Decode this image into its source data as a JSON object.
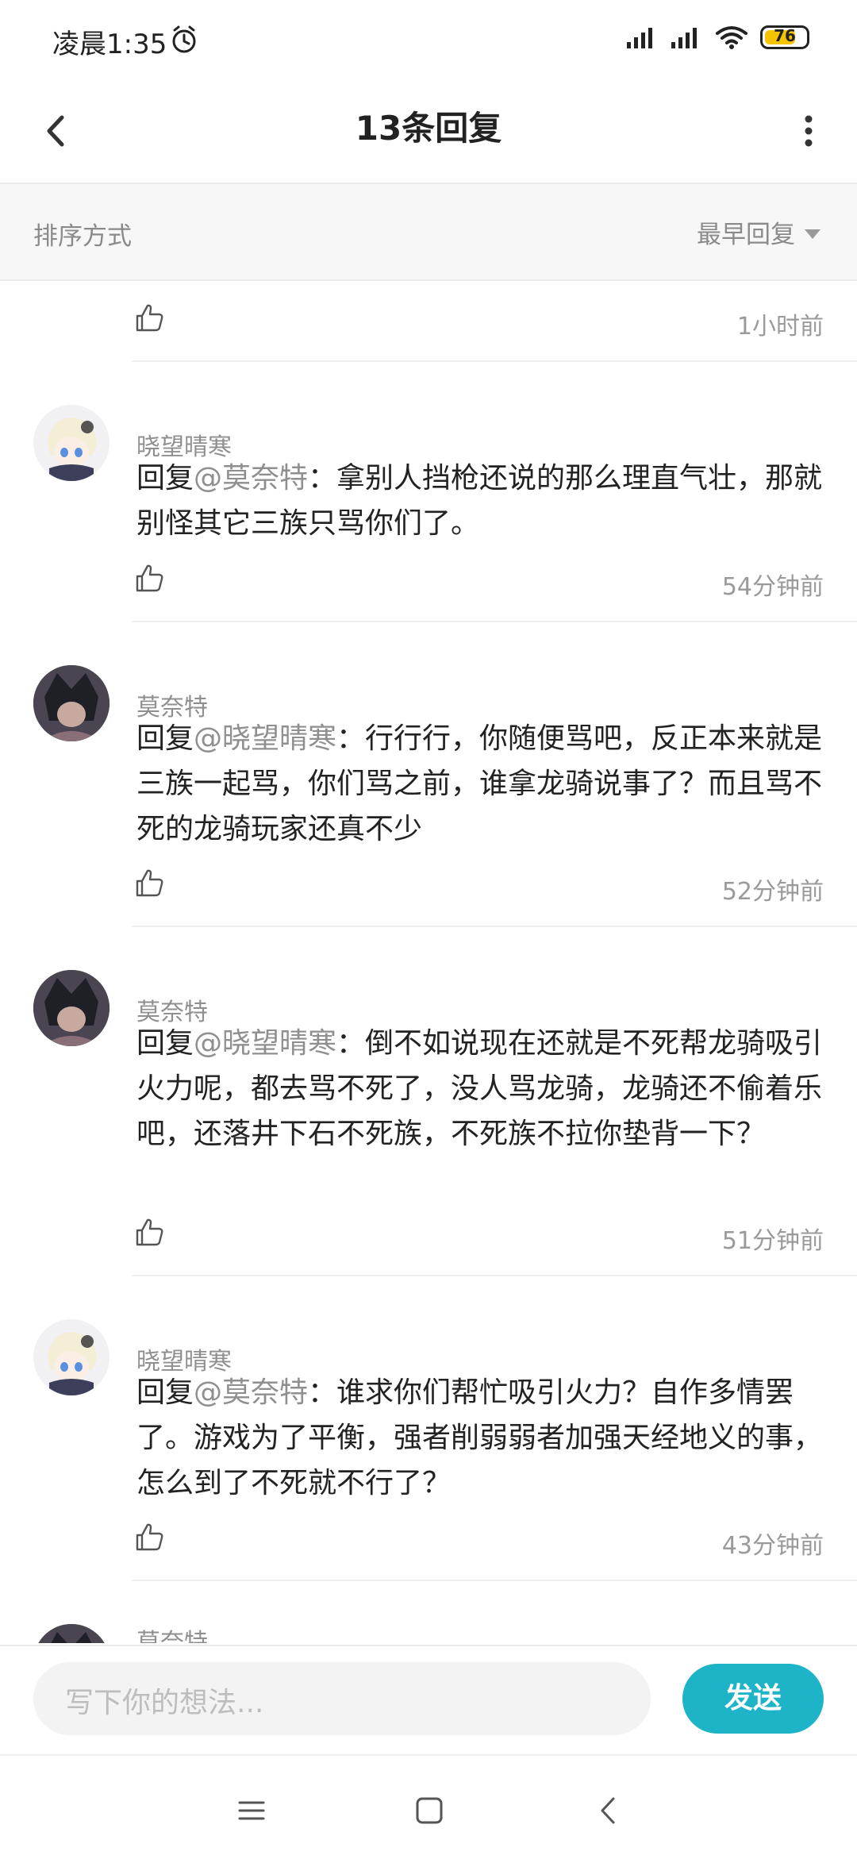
{
  "status_bar": {
    "time": "凌晨1:35",
    "battery": "76"
  },
  "header": {
    "title": "13条回复"
  },
  "sort": {
    "label": "排序方式",
    "selected": "最早回复"
  },
  "first_meta": {
    "time": "1小时前"
  },
  "comments": [
    {
      "user": "晓望晴寒",
      "prefix": "回复",
      "mention": "@莫奈特",
      "text": "：拿别人挡枪还说的那么理直气壮，那就别怪其它三族只骂你们了。",
      "time": "54分钟前"
    },
    {
      "user": "莫奈特",
      "prefix": "回复",
      "mention": "@晓望晴寒",
      "text": "：行行行，你随便骂吧，反正本来就是三族一起骂，你们骂之前，谁拿龙骑说事了？而且骂不死的龙骑玩家还真不少",
      "time": "52分钟前"
    },
    {
      "user": "莫奈特",
      "prefix": "回复",
      "mention": "@晓望晴寒",
      "text": "：倒不如说现在还就是不死帮龙骑吸引火力呢，都去骂不死了，没人骂龙骑，龙骑还不偷着乐吧，还落井下石不死族，不死族不拉你垫背一下？",
      "time": "51分钟前"
    },
    {
      "user": "晓望晴寒",
      "prefix": "回复",
      "mention": "@莫奈特",
      "text": "：谁求你们帮忙吸引火力？自作多情罢了。游戏为了平衡，强者削弱弱者加强天经地义的事，怎么到了不死就不行了？",
      "time": "43分钟前"
    },
    {
      "user": "莫奈特"
    }
  ],
  "input": {
    "placeholder": "写下你的想法...",
    "send_label": "发送"
  },
  "colors": {
    "accent": "#1cb4c6",
    "battery": "#f5c400"
  }
}
